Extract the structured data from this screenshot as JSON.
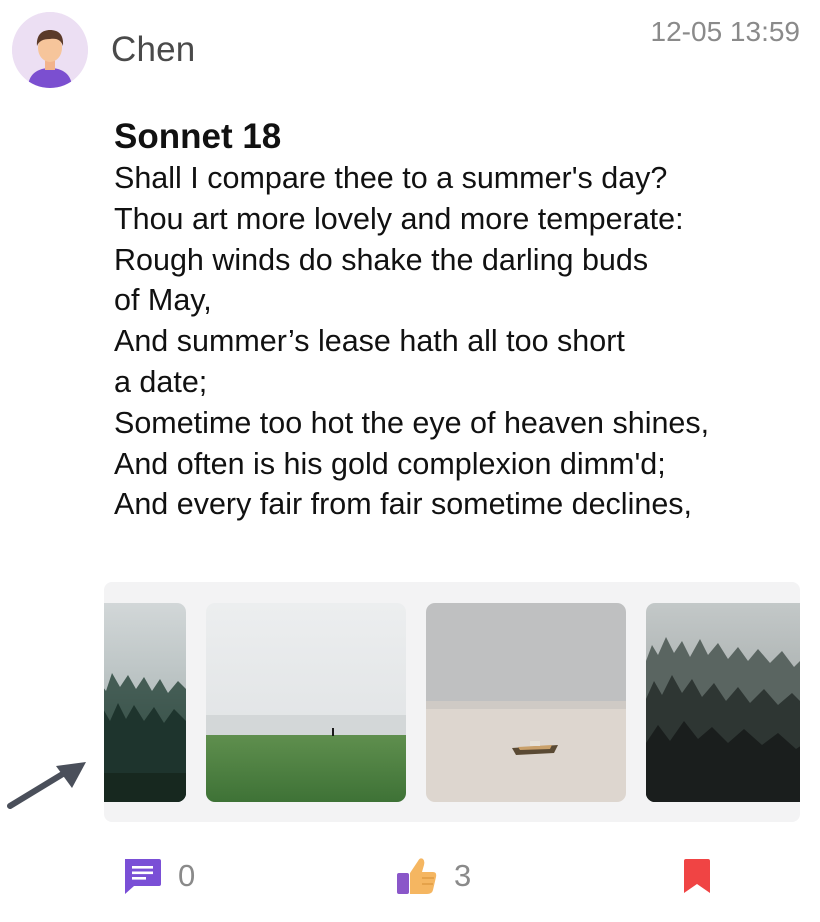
{
  "post": {
    "author": "Chen",
    "timestamp": "12-05 13:59",
    "avatar_icon": "user-avatar-icon"
  },
  "poem": {
    "title": "Sonnet 18",
    "lines": [
      "Shall I compare thee to a summer's day?",
      "Thou art more lovely and more temperate:",
      "Rough winds do shake the darling buds",
      "of May,",
      "And summer’s lease hath all too short",
      "a date;",
      "Sometime too hot the eye of heaven shines,",
      "And often is his gold complexion dimm'd;",
      "And every fair from fair sometime declines,"
    ]
  },
  "gallery": {
    "images": [
      {
        "subject": "misty forest edge"
      },
      {
        "subject": "foggy green field with lone figure"
      },
      {
        "subject": "small boat on a misty beach"
      },
      {
        "subject": "fog over a pine forest"
      }
    ]
  },
  "actions": {
    "comment": {
      "icon": "comment-icon",
      "count": "0",
      "color": "#7a4fd6"
    },
    "like": {
      "icon": "thumbs-up-icon",
      "count": "3",
      "color": "#f5b661"
    },
    "bookmark": {
      "icon": "bookmark-icon",
      "color": "#f04444"
    }
  },
  "annotation": {
    "icon": "pointer-arrow-icon",
    "color": "#4a4f5a"
  }
}
